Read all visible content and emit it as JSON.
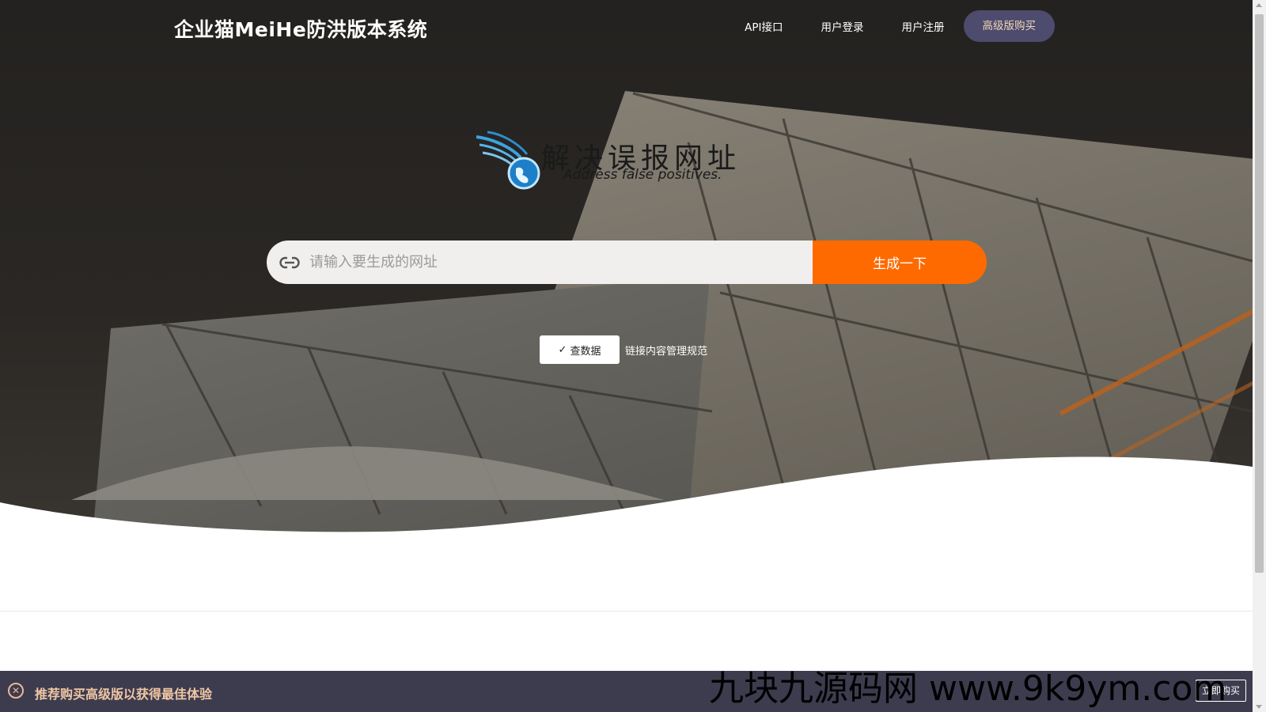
{
  "header": {
    "brand": "企业猫MeiHe防洪版本系统",
    "nav": [
      {
        "label": "API接口"
      },
      {
        "label": "用户登录"
      },
      {
        "label": "用户注册"
      },
      {
        "label": "高级版购买"
      }
    ]
  },
  "logo": {
    "title": "解决误报网址",
    "subtitle": "Address false positives."
  },
  "search": {
    "placeholder": "请输入要生成的网址",
    "value": "",
    "button_label": "生成一下"
  },
  "tools": {
    "check_label": "查数据",
    "rules_link": "链接内容管理规范"
  },
  "bottom_bar": {
    "message": "推荐购买高级版以获得最佳体验",
    "cta_label": "立即购买"
  },
  "watermark": "九块九源码网 www.9k9ym.com",
  "colors": {
    "accent": "#ff6a00",
    "buy_button": "#4d4b6e",
    "bottom_bar": "#3d3c4f",
    "bottom_text": "#f0c7a4"
  },
  "icons": {
    "search_field": "link-icon",
    "check": "checkmark-icon",
    "close": "close-icon"
  }
}
